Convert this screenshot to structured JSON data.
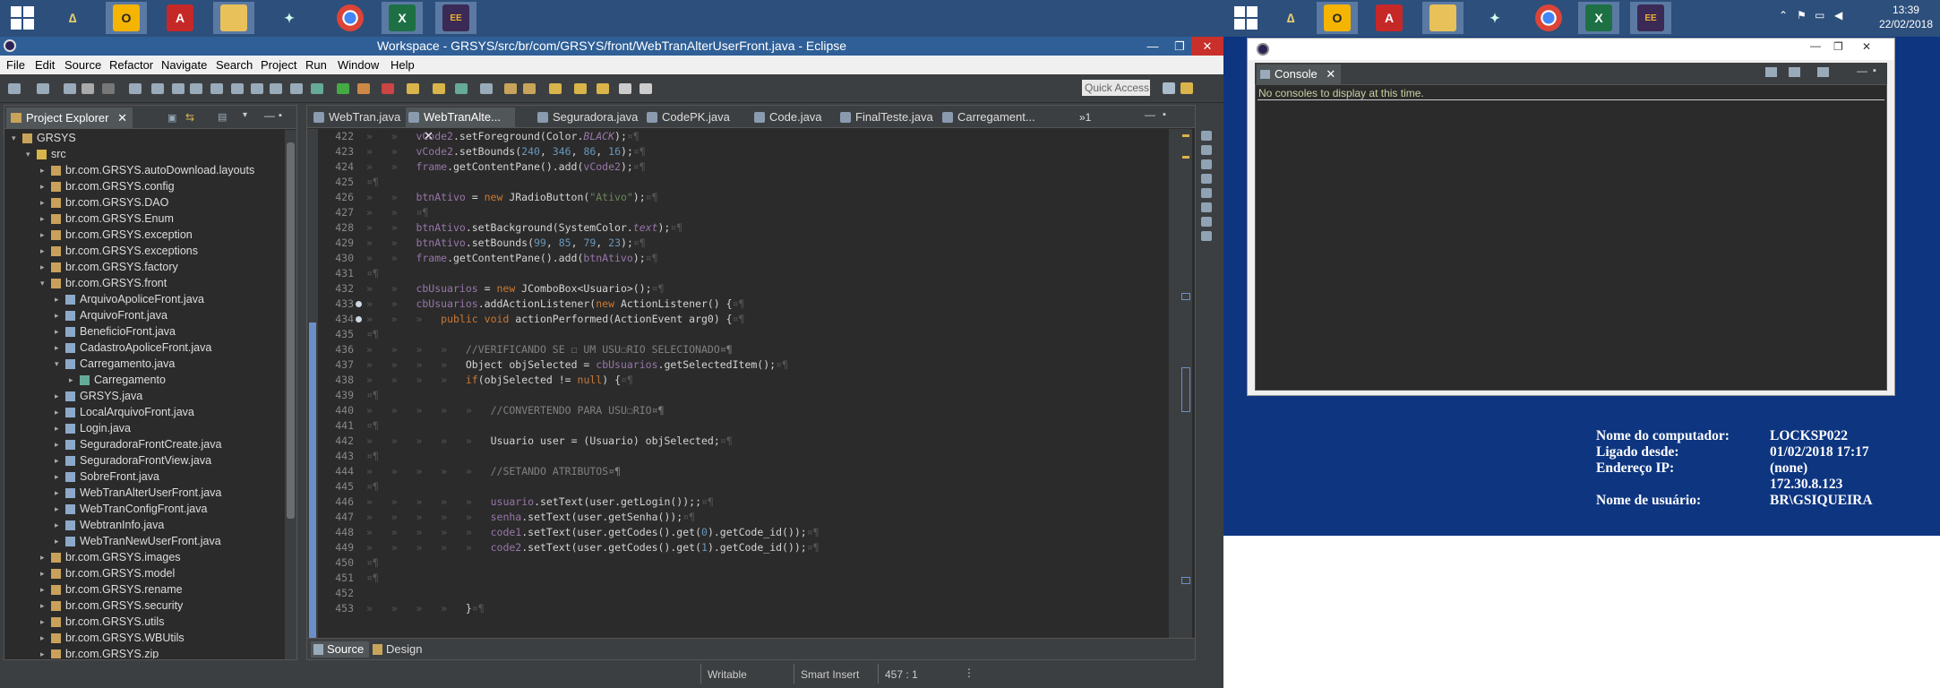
{
  "taskbar_left": {
    "apps": [
      "start-icon",
      "anydesk-icon",
      "outlook-icon",
      "acrobat-icon",
      "file-explorer-icon",
      "network-icon",
      "chrome-icon",
      "excel-icon",
      "java-ee-icon"
    ]
  },
  "taskbar_right": {
    "apps": [
      "start-icon",
      "anydesk-icon",
      "outlook-icon",
      "acrobat-icon",
      "file-explorer-icon",
      "network-icon",
      "chrome-icon",
      "excel-icon",
      "java-ee-icon"
    ],
    "time": "13:39",
    "date": "22/02/2018"
  },
  "eclipse": {
    "title": "Workspace - GRSYS/src/br/com/GRSYS/front/WebTranAlterUserFront.java - Eclipse",
    "menu": [
      "File",
      "Edit",
      "Source",
      "Refactor",
      "Navigate",
      "Search",
      "Project",
      "Run",
      "Window",
      "Help"
    ],
    "quick_access": "Quick Access",
    "project_explorer": {
      "tab": "Project Explorer",
      "tree": [
        {
          "label": "GRSYS",
          "level": 0,
          "arrow": "▾",
          "icon": "project"
        },
        {
          "label": "src",
          "level": 1,
          "arrow": "▾",
          "icon": "srcfolder"
        },
        {
          "label": "br.com.GRSYS.autoDownload.layouts",
          "level": 2,
          "arrow": "▸",
          "icon": "package"
        },
        {
          "label": "br.com.GRSYS.config",
          "level": 2,
          "arrow": "▸",
          "icon": "package"
        },
        {
          "label": "br.com.GRSYS.DAO",
          "level": 2,
          "arrow": "▸",
          "icon": "package"
        },
        {
          "label": "br.com.GRSYS.Enum",
          "level": 2,
          "arrow": "▸",
          "icon": "package"
        },
        {
          "label": "br.com.GRSYS.exception",
          "level": 2,
          "arrow": "▸",
          "icon": "package"
        },
        {
          "label": "br.com.GRSYS.exceptions",
          "level": 2,
          "arrow": "▸",
          "icon": "package"
        },
        {
          "label": "br.com.GRSYS.factory",
          "level": 2,
          "arrow": "▸",
          "icon": "package"
        },
        {
          "label": "br.com.GRSYS.front",
          "level": 2,
          "arrow": "▾",
          "icon": "package"
        },
        {
          "label": "ArquivoApoliceFront.java",
          "level": 3,
          "arrow": "▸",
          "icon": "java"
        },
        {
          "label": "ArquivoFront.java",
          "level": 3,
          "arrow": "▸",
          "icon": "java"
        },
        {
          "label": "BeneficioFront.java",
          "level": 3,
          "arrow": "▸",
          "icon": "java"
        },
        {
          "label": "CadastroApoliceFront.java",
          "level": 3,
          "arrow": "▸",
          "icon": "java"
        },
        {
          "label": "Carregamento.java",
          "level": 3,
          "arrow": "▾",
          "icon": "java"
        },
        {
          "label": "Carregamento",
          "level": 4,
          "arrow": "▸",
          "icon": "class"
        },
        {
          "label": "GRSYS.java",
          "level": 3,
          "arrow": "▸",
          "icon": "java"
        },
        {
          "label": "LocalArquivoFront.java",
          "level": 3,
          "arrow": "▸",
          "icon": "java"
        },
        {
          "label": "Login.java",
          "level": 3,
          "arrow": "▸",
          "icon": "java"
        },
        {
          "label": "SeguradoraFrontCreate.java",
          "level": 3,
          "arrow": "▸",
          "icon": "java"
        },
        {
          "label": "SeguradoraFrontView.java",
          "level": 3,
          "arrow": "▸",
          "icon": "java"
        },
        {
          "label": "SobreFront.java",
          "level": 3,
          "arrow": "▸",
          "icon": "java"
        },
        {
          "label": "WebTranAlterUserFront.java",
          "level": 3,
          "arrow": "▸",
          "icon": "java"
        },
        {
          "label": "WebTranConfigFront.java",
          "level": 3,
          "arrow": "▸",
          "icon": "java"
        },
        {
          "label": "WebtranInfo.java",
          "level": 3,
          "arrow": "▸",
          "icon": "java"
        },
        {
          "label": "WebTranNewUserFront.java",
          "level": 3,
          "arrow": "▸",
          "icon": "java"
        },
        {
          "label": "br.com.GRSYS.images",
          "level": 2,
          "arrow": "▸",
          "icon": "package"
        },
        {
          "label": "br.com.GRSYS.model",
          "level": 2,
          "arrow": "▸",
          "icon": "package"
        },
        {
          "label": "br.com.GRSYS.rename",
          "level": 2,
          "arrow": "▸",
          "icon": "package"
        },
        {
          "label": "br.com.GRSYS.security",
          "level": 2,
          "arrow": "▸",
          "icon": "package"
        },
        {
          "label": "br.com.GRSYS.utils",
          "level": 2,
          "arrow": "▸",
          "icon": "package"
        },
        {
          "label": "br.com.GRSYS.WBUtils",
          "level": 2,
          "arrow": "▸",
          "icon": "package"
        },
        {
          "label": "br.com.GRSYS.zip",
          "level": 2,
          "arrow": "▸",
          "icon": "package"
        }
      ]
    },
    "editor_tabs": [
      "WebTran.java",
      "WebTranAlte...",
      "Seguradora.java",
      "CodePK.java",
      "Code.java",
      "FinalTeste.java",
      "Carregament..."
    ],
    "editor_tab_overflow": "»1",
    "active_tab_index": 1,
    "code_lines": [
      {
        "n": "422",
        "t": "»   »   vCode2.setForeground(Color.BLACK);¤¶"
      },
      {
        "n": "423",
        "t": "»   »   vCode2.setBounds(240, 346, 86, 16);¤¶"
      },
      {
        "n": "424",
        "t": "»   »   frame.getContentPane().add(vCode2);¤¶"
      },
      {
        "n": "425",
        "t": "¤¶"
      },
      {
        "n": "426",
        "t": "»   »   btnAtivo = new JRadioButton(\"Ativo\");¤¶"
      },
      {
        "n": "427",
        "t": "»   »   ¤¶"
      },
      {
        "n": "428",
        "t": "»   »   btnAtivo.setBackground(SystemColor.text);¤¶"
      },
      {
        "n": "429",
        "t": "»   »   btnAtivo.setBounds(99, 85, 79, 23);¤¶"
      },
      {
        "n": "430",
        "t": "»   »   frame.getContentPane().add(btnAtivo);¤¶"
      },
      {
        "n": "431",
        "t": "¤¶"
      },
      {
        "n": "432",
        "t": "»   »   cbUsuarios = new JComboBox<Usuario>();¤¶"
      },
      {
        "n": "433",
        "t": "»   »   cbUsuarios.addActionListener(new ActionListener() {¤¶"
      },
      {
        "n": "434",
        "t": "»   »   »   public void actionPerformed(ActionEvent arg0) {¤¶"
      },
      {
        "n": "435",
        "t": "¤¶"
      },
      {
        "n": "436",
        "t": "»   »   »   »   //VERIFICANDO SE ☐ UM USU☐RIO SELECIONADO¤¶"
      },
      {
        "n": "437",
        "t": "»   »   »   »   Object objSelected = cbUsuarios.getSelectedItem();¤¶"
      },
      {
        "n": "438",
        "t": "»   »   »   »   if(objSelected != null) {¤¶"
      },
      {
        "n": "439",
        "t": "¤¶"
      },
      {
        "n": "440",
        "t": "»   »   »   »   »   //CONVERTENDO PARA USU☐RIO¤¶"
      },
      {
        "n": "441",
        "t": "¤¶"
      },
      {
        "n": "442",
        "t": "»   »   »   »   »   Usuario user = (Usuario) objSelected;¤¶"
      },
      {
        "n": "443",
        "t": "¤¶"
      },
      {
        "n": "444",
        "t": "»   »   »   »   »   //SETANDO ATRIBUTOS¤¶"
      },
      {
        "n": "445",
        "t": "¤¶"
      },
      {
        "n": "446",
        "t": "»   »   »   »   »   usuario.setText(user.getLogin());;¤¶"
      },
      {
        "n": "447",
        "t": "»   »   »   »   »   senha.setText(user.getSenha());¤¶"
      },
      {
        "n": "448",
        "t": "»   »   »   »   »   code1.setText(user.getCodes().get(0).getCode_id());¤¶"
      },
      {
        "n": "449",
        "t": "»   »   »   »   »   code2.setText(user.getCodes().get(1).getCode_id());¤¶"
      },
      {
        "n": "450",
        "t": "¤¶"
      },
      {
        "n": "451",
        "t": "¤¶"
      },
      {
        "n": "452",
        "t": ""
      },
      {
        "n": "453",
        "t": "»   »   »   »   }¤¶"
      }
    ],
    "bottom_tabs": [
      "Source",
      "Design"
    ],
    "status": {
      "writable": "Writable",
      "insert": "Smart Insert",
      "position": "457 : 1"
    }
  },
  "console": {
    "tab": "Console",
    "message": "No consoles to display at this time."
  },
  "sysinfo": {
    "labels": [
      "Nome do computador:",
      "Ligado desde:",
      "Endereço IP:",
      "",
      "Nome de usuário:"
    ],
    "values": [
      "LOCKSP022",
      "01/02/2018 17:17",
      "(none)",
      "172.30.8.123",
      "BR\\GSIQUEIRA"
    ]
  },
  "colors": {
    "titlebar": "#2f5f96",
    "desktop": "#0d3580",
    "keyword": "#cc7832",
    "field": "#9876aa",
    "string": "#6a8759",
    "comment": "#808080",
    "number": "#6897bb"
  }
}
